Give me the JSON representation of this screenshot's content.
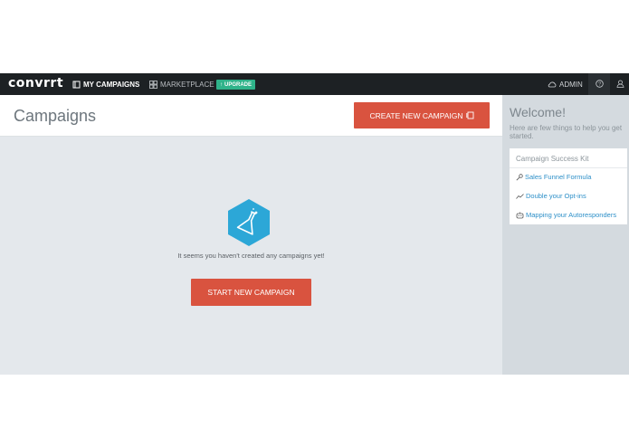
{
  "nav": {
    "logo": "convrrt",
    "my_campaigns": "MY CAMPAIGNS",
    "marketplace": "MARKETPLACE",
    "upgrade": "UPGRADE",
    "admin": "ADMIN"
  },
  "header": {
    "title": "Campaigns",
    "create_button": "CREATE NEW CAMPAIGN"
  },
  "empty_state": {
    "message": "It seems you haven't created any campaigns yet!",
    "start_button": "START NEW CAMPAIGN"
  },
  "sidebar": {
    "welcome_title": "Welcome!",
    "welcome_sub": "Here are few things to help you get started.",
    "kit_title": "Campaign Success Kit",
    "links": [
      {
        "label": "Sales Funnel Formula",
        "icon": "key-icon"
      },
      {
        "label": "Double your Opt-ins",
        "icon": "trend-icon"
      },
      {
        "label": "Mapping your Autoresponders",
        "icon": "robot-icon"
      }
    ]
  },
  "colors": {
    "nav_bg": "#1d2124",
    "accent_red": "#d9533f",
    "hex_blue": "#2ca7d7",
    "upgrade_green": "#2fb38a",
    "link_blue": "#2c8fc8"
  }
}
